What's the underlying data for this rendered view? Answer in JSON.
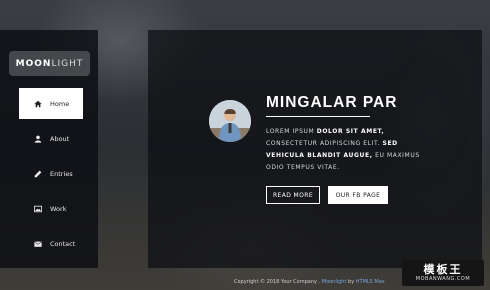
{
  "sidebar": {
    "logo_bold": "MOON",
    "logo_light": "LIGHT",
    "items": [
      {
        "label": "Home",
        "icon": "home-icon",
        "active": true
      },
      {
        "label": "About",
        "icon": "user-icon"
      },
      {
        "label": "Entries",
        "icon": "pencil-icon"
      },
      {
        "label": "Work",
        "icon": "image-icon"
      },
      {
        "label": "Contact",
        "icon": "envelope-icon"
      }
    ]
  },
  "main": {
    "heading": "MINGALAR PAR",
    "para": {
      "t1": "LOREM IPSUM ",
      "b1": "DOLOR SIT AMET,",
      "t2": " CONSECTETUR ADIPISCING ELIT. ",
      "b2": "SED VEHICULA BLANDIT AUGUE,",
      "t3": " EU MAXIMUS ODIO TEMPUS VITAE."
    },
    "read_more": "READ MORE",
    "fb_page": "OUR FB PAGE"
  },
  "footer": {
    "copyright": "Copyright © 2018 Your Company . ",
    "theme": "Moonlight",
    "by": " by ",
    "source": "HTML5 Max"
  },
  "watermark": {
    "cn": "模板王",
    "en": "MOBANWANG.COM"
  },
  "colors": {
    "panel": "#0c0e12",
    "active_item": "#ffffff",
    "footer_link": "#7aa6d8"
  }
}
